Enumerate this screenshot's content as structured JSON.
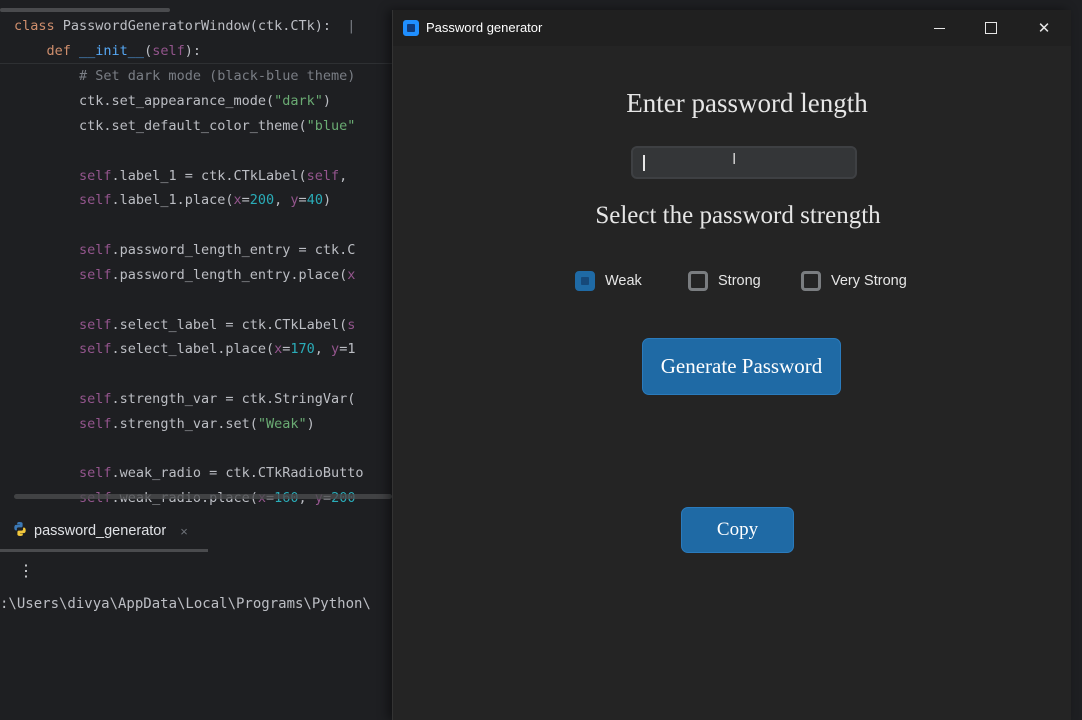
{
  "ide": {
    "code_lines": [
      {
        "segments": [
          [
            "kw",
            "class "
          ],
          [
            "",
            "PasswordGeneratorWindow(ctk.CTk):  "
          ],
          [
            "cm",
            "|"
          ]
        ]
      },
      {
        "segments": [
          [
            "",
            "    "
          ],
          [
            "kw",
            "def "
          ],
          [
            "fn",
            "__init__"
          ],
          [
            "",
            "("
          ],
          [
            "sf",
            "self"
          ],
          [
            "",
            "):"
          ]
        ]
      },
      {
        "segments": [
          [
            "",
            "        "
          ],
          [
            "cm",
            "# Set dark mode (black-blue theme)"
          ]
        ]
      },
      {
        "segments": [
          [
            "",
            "        ctk.set_appearance_mode("
          ],
          [
            "st",
            "\"dark\""
          ],
          [
            "",
            ")"
          ]
        ]
      },
      {
        "segments": [
          [
            "",
            "        ctk.set_default_color_theme("
          ],
          [
            "st",
            "\"blue\""
          ]
        ]
      },
      {
        "segments": [
          [
            "",
            ""
          ]
        ]
      },
      {
        "segments": [
          [
            "",
            "        "
          ],
          [
            "sf",
            "self"
          ],
          [
            "",
            ".label_1 = ctk.CTkLabel("
          ],
          [
            "sf",
            "self"
          ],
          [
            "",
            ","
          ]
        ]
      },
      {
        "segments": [
          [
            "",
            "        "
          ],
          [
            "sf",
            "self"
          ],
          [
            "",
            ".label_1.place("
          ],
          [
            "sf",
            "x"
          ],
          [
            "",
            "="
          ],
          [
            "nm",
            "200"
          ],
          [
            "",
            ", "
          ],
          [
            "sf",
            "y"
          ],
          [
            "",
            "="
          ],
          [
            "nm",
            "40"
          ],
          [
            "",
            ")"
          ]
        ]
      },
      {
        "segments": [
          [
            "",
            ""
          ]
        ]
      },
      {
        "segments": [
          [
            "",
            "        "
          ],
          [
            "sf",
            "self"
          ],
          [
            "",
            ".password_length_entry = ctk.C"
          ]
        ]
      },
      {
        "segments": [
          [
            "",
            "        "
          ],
          [
            "sf",
            "self"
          ],
          [
            "",
            ".password_length_entry.place("
          ],
          [
            "sf",
            "x"
          ]
        ]
      },
      {
        "segments": [
          [
            "",
            ""
          ]
        ]
      },
      {
        "segments": [
          [
            "",
            "        "
          ],
          [
            "sf",
            "self"
          ],
          [
            "",
            ".select_label = ctk.CTkLabel("
          ],
          [
            "sf",
            "s"
          ]
        ]
      },
      {
        "segments": [
          [
            "",
            "        "
          ],
          [
            "sf",
            "self"
          ],
          [
            "",
            ".select_label.place("
          ],
          [
            "sf",
            "x"
          ],
          [
            "",
            "="
          ],
          [
            "nm",
            "170"
          ],
          [
            "",
            ", "
          ],
          [
            "sf",
            "y"
          ],
          [
            "",
            "=1"
          ]
        ]
      },
      {
        "segments": [
          [
            "",
            ""
          ]
        ]
      },
      {
        "segments": [
          [
            "",
            "        "
          ],
          [
            "sf",
            "self"
          ],
          [
            "",
            ".strength_var = ctk.StringVar("
          ]
        ]
      },
      {
        "segments": [
          [
            "",
            "        "
          ],
          [
            "sf",
            "self"
          ],
          [
            "",
            ".strength_var.set("
          ],
          [
            "st",
            "\"Weak\""
          ],
          [
            "",
            ")"
          ]
        ]
      },
      {
        "segments": [
          [
            "",
            ""
          ]
        ]
      },
      {
        "segments": [
          [
            "",
            "        "
          ],
          [
            "sf",
            "self"
          ],
          [
            "",
            ".weak_radio = ctk.CTkRadioButto"
          ]
        ]
      },
      {
        "segments": [
          [
            "",
            "        "
          ],
          [
            "sf",
            "self"
          ],
          [
            "",
            ".weak_radio.place("
          ],
          [
            "sf",
            "x"
          ],
          [
            "",
            "="
          ],
          [
            "nm",
            "160"
          ],
          [
            "",
            ", "
          ],
          [
            "sf",
            "y"
          ],
          [
            "",
            "="
          ],
          [
            "nm",
            "200"
          ]
        ]
      }
    ],
    "run_tab": {
      "label": "password_generator",
      "close": "×"
    },
    "run_more": "⋮",
    "run_path": ":\\Users\\divya\\AppData\\Local\\Programs\\Python\\"
  },
  "app": {
    "window_title": "Password generator",
    "controls": {
      "minimize": "",
      "maximize": "",
      "close": "✕"
    },
    "heading_length": "Enter password length",
    "length_value": "",
    "heading_strength": "Select the password strength",
    "strength_options": [
      {
        "label": "Weak",
        "checked": true
      },
      {
        "label": "Strong",
        "checked": false
      },
      {
        "label": "Very Strong",
        "checked": false
      }
    ],
    "generate_label": "Generate Password",
    "copy_label": "Copy"
  },
  "colors": {
    "accent": "#1f6aa5",
    "window_bg": "#242424",
    "ide_bg": "#1e1f22"
  }
}
